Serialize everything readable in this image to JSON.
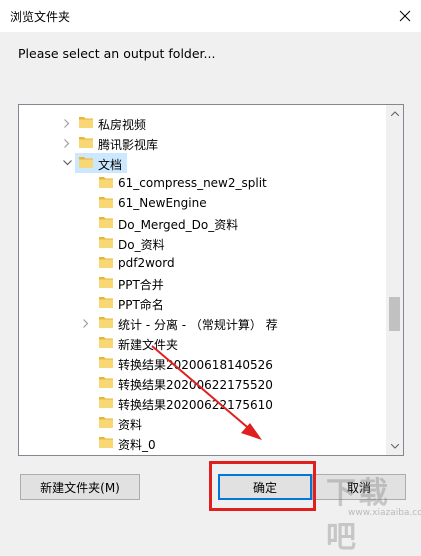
{
  "window": {
    "title": "浏览文件夹",
    "close_icon": "close-icon"
  },
  "prompt": "Please select an output folder...",
  "tree": {
    "items": [
      {
        "label": "私房视频",
        "expandable": true,
        "expanded": false,
        "level": 1,
        "selected": false
      },
      {
        "label": "腾讯影视库",
        "expandable": true,
        "expanded": false,
        "level": 1,
        "selected": false
      },
      {
        "label": "文档",
        "expandable": true,
        "expanded": true,
        "level": 1,
        "selected": true
      },
      {
        "label": "61_compress_new2_split",
        "expandable": false,
        "expanded": false,
        "level": 2,
        "selected": false
      },
      {
        "label": "61_NewEngine",
        "expandable": false,
        "expanded": false,
        "level": 2,
        "selected": false
      },
      {
        "label": "Do_Merged_Do_资料",
        "expandable": false,
        "expanded": false,
        "level": 2,
        "selected": false
      },
      {
        "label": "Do_资料",
        "expandable": false,
        "expanded": false,
        "level": 2,
        "selected": false
      },
      {
        "label": "pdf2word",
        "expandable": false,
        "expanded": false,
        "level": 2,
        "selected": false
      },
      {
        "label": "PPT合并",
        "expandable": false,
        "expanded": false,
        "level": 2,
        "selected": false
      },
      {
        "label": "PPT命名",
        "expandable": false,
        "expanded": false,
        "level": 2,
        "selected": false
      },
      {
        "label": "统计 - 分离 - （常规计算） 荐",
        "expandable": true,
        "expanded": false,
        "level": 2,
        "selected": false
      },
      {
        "label": "新建文件夹",
        "expandable": false,
        "expanded": false,
        "level": 2,
        "selected": false
      },
      {
        "label": "转换结果20200618140526",
        "expandable": false,
        "expanded": false,
        "level": 2,
        "selected": false
      },
      {
        "label": "转换结果20200622175520",
        "expandable": false,
        "expanded": false,
        "level": 2,
        "selected": false
      },
      {
        "label": "转换结果20200622175610",
        "expandable": false,
        "expanded": false,
        "level": 2,
        "selected": false
      },
      {
        "label": "资料",
        "expandable": false,
        "expanded": false,
        "level": 2,
        "selected": false
      },
      {
        "label": "资料_0",
        "expandable": false,
        "expanded": false,
        "level": 2,
        "selected": false
      }
    ],
    "scroll_position": 0.62
  },
  "buttons": {
    "new_folder": "新建文件夹(M)",
    "ok": "确定",
    "cancel": "取消"
  },
  "colors": {
    "folder": "#f8d775",
    "folder_dark": "#e8b73a",
    "selection": "#cce8ff",
    "annotation": "#e0201f",
    "default_border": "#0078d7"
  },
  "watermark": {
    "text": "下载吧",
    "sub": "www.xiazaiba.com"
  }
}
